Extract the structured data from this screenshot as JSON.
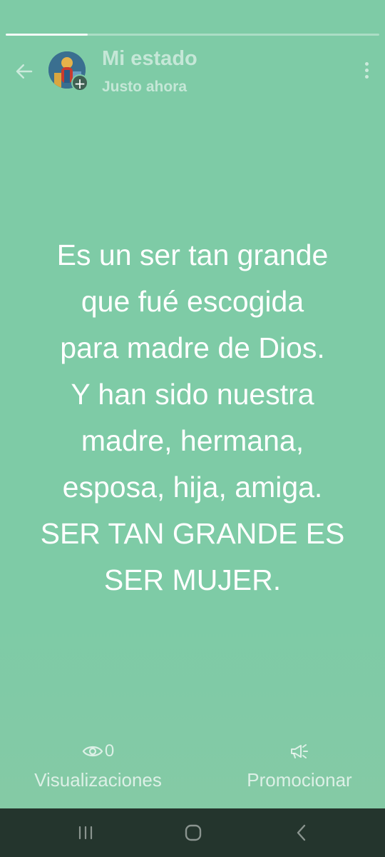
{
  "progress": {
    "fraction": 0.22
  },
  "header": {
    "title": "Mi estado",
    "subtitle": "Justo ahora",
    "avatar_badge": "+"
  },
  "status": {
    "text": "Es un ser tan grande\nque fué escogida\npara madre de Dios.\nY han sido nuestra\nmadre, hermana,\nesposa, hija, amiga.\nSER TAN GRANDE ES\nSER MUJER.",
    "background_color": "#7ecba6",
    "text_color": "#ffffff"
  },
  "actions": {
    "views_count": "0",
    "views_label": "Visualizaciones",
    "promote_label": "Promocionar"
  },
  "icons": {
    "back": "arrow-left-icon",
    "menu": "more-vert-icon",
    "views": "eye-icon",
    "promote": "megaphone-icon",
    "nav_recents": "recents-icon",
    "nav_home": "home-icon",
    "nav_back": "chevron-left-icon"
  }
}
